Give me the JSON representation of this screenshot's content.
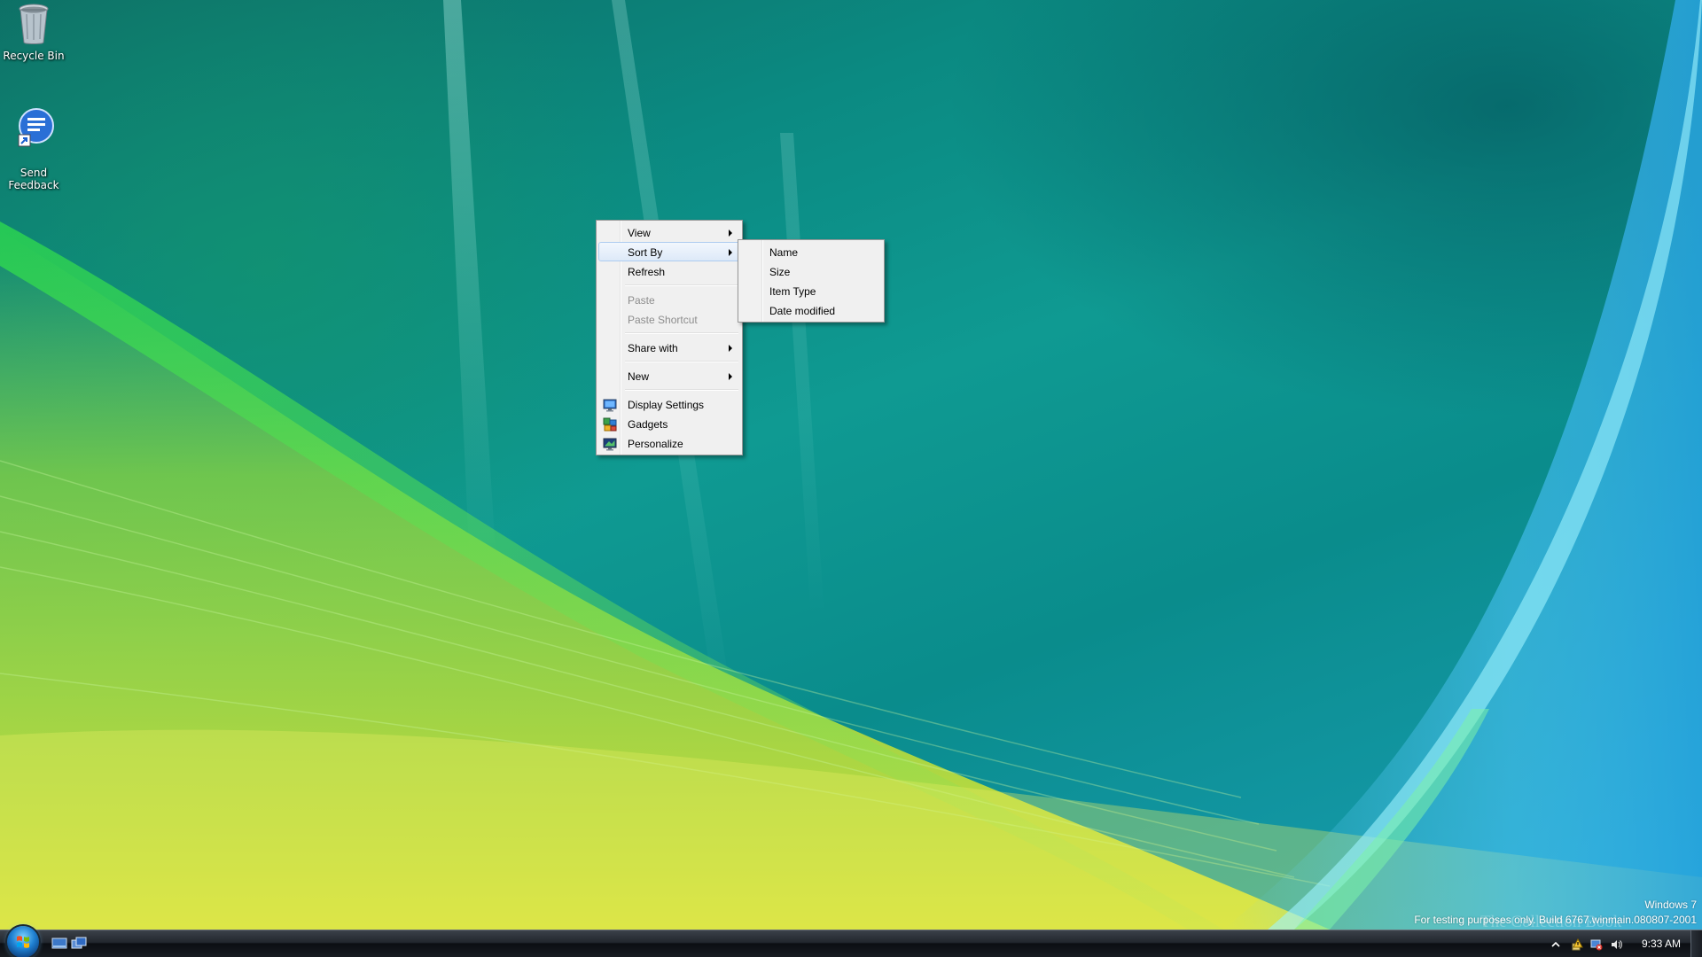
{
  "desktop": {
    "icons": [
      {
        "label": "Recycle Bin",
        "icon": "recycle-bin-icon"
      },
      {
        "label": "Send\nFeedback",
        "icon": "send-feedback-icon"
      }
    ]
  },
  "context_menu": {
    "items": {
      "view": "View",
      "sort_by": "Sort By",
      "refresh": "Refresh",
      "paste": "Paste",
      "paste_shortcut": "Paste Shortcut",
      "share_with": "Share with",
      "new": "New",
      "display_settings": "Display Settings",
      "gadgets": "Gadgets",
      "personalize": "Personalize"
    },
    "highlighted": "Sort By"
  },
  "sort_by_submenu": {
    "items": [
      "Name",
      "Size",
      "Item Type",
      "Date modified"
    ]
  },
  "watermark": {
    "line1": "Windows 7",
    "line2": "For testing purposes only. Build 6767.winmain.080807-2001",
    "stamp": "The Collection Book"
  },
  "taskbar": {
    "clock": "9:33 AM"
  },
  "colors": {
    "menu_bg": "#f0f0f0",
    "menu_border": "#979797",
    "highlight_border": "#aeccf0",
    "disabled_text": "#8d8d8d"
  }
}
